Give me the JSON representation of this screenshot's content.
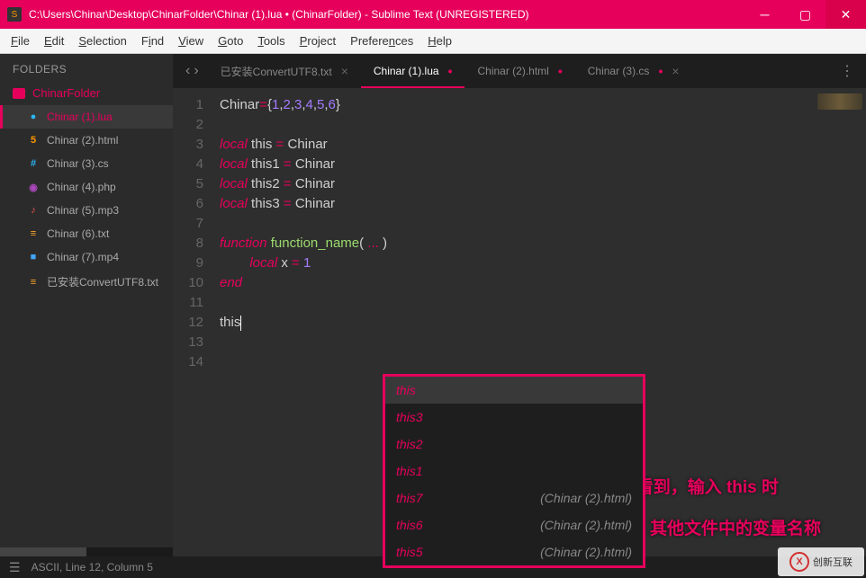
{
  "title": "C:\\Users\\Chinar\\Desktop\\ChinarFolder\\Chinar (1).lua • (ChinarFolder) - Sublime Text (UNREGISTERED)",
  "titlebar_icon": "S",
  "menu": [
    "File",
    "Edit",
    "Selection",
    "Find",
    "View",
    "Goto",
    "Tools",
    "Project",
    "Preferences",
    "Help"
  ],
  "sidebar": {
    "header": "FOLDERS",
    "folder": "ChinarFolder",
    "files": [
      {
        "name": "Chinar (1).lua",
        "icon": "●",
        "cls": "ic-lua",
        "active": true
      },
      {
        "name": "Chinar (2).html",
        "icon": "5",
        "cls": "ic-html"
      },
      {
        "name": "Chinar (3).cs",
        "icon": "#",
        "cls": "ic-cs"
      },
      {
        "name": "Chinar (4).php",
        "icon": "◉",
        "cls": "ic-php"
      },
      {
        "name": "Chinar (5).mp3",
        "icon": "♪",
        "cls": "ic-mp3"
      },
      {
        "name": "Chinar (6).txt",
        "icon": "≡",
        "cls": "ic-txt"
      },
      {
        "name": "Chinar (7).mp4",
        "icon": "■",
        "cls": "ic-mp4"
      },
      {
        "name": "已安装ConvertUTF8.txt",
        "icon": "≡",
        "cls": "ic-txt"
      }
    ]
  },
  "tabs": [
    {
      "label": "已安装ConvertUTF8.txt",
      "dirty": false,
      "active": false,
      "showclose": true
    },
    {
      "label": "Chinar (1).lua",
      "dirty": true,
      "active": true
    },
    {
      "label": "Chinar (2).html",
      "dirty": true,
      "active": false
    },
    {
      "label": "Chinar (3).cs",
      "dirty": true,
      "active": false,
      "showclose": true
    }
  ],
  "code": {
    "lines": [
      "1",
      "2",
      "3",
      "4",
      "5",
      "6",
      "7",
      "8",
      "9",
      "10",
      "11",
      "12",
      "13",
      "14"
    ],
    "l1_ident": "Chinar",
    "l1_vals": [
      "1",
      "2",
      "3",
      "4",
      "5",
      "6"
    ],
    "l3_kw": "local",
    "l3_v": "this",
    "l3_r": "Chinar",
    "l4_kw": "local",
    "l4_v": "this1",
    "l4_r": "Chinar",
    "l5_kw": "local",
    "l5_v": "this2",
    "l5_r": "Chinar",
    "l6_kw": "local",
    "l6_v": "this3",
    "l6_r": "Chinar",
    "l8_kw": "function",
    "l8_fn": "function_name",
    "l8_args": "...",
    "l9_kw": "local",
    "l9_v": "x",
    "l9_r": "1",
    "l10_kw": "end",
    "l12_text": "this"
  },
  "autocomplete": [
    {
      "t": "this",
      "hint": "",
      "sel": true
    },
    {
      "t": "this3",
      "hint": ""
    },
    {
      "t": "this2",
      "hint": ""
    },
    {
      "t": "this1",
      "hint": ""
    },
    {
      "t": "this7",
      "hint": "(Chinar (2).html)"
    },
    {
      "t": "this6",
      "hint": "(Chinar (2).html)"
    },
    {
      "t": "this5",
      "hint": "(Chinar (2).html)"
    }
  ],
  "annotation": {
    "line1": "可以看到，输入 this 时",
    "line2": "会自动提示 其他文件中的变量名称"
  },
  "status": "ASCII, Line 12, Column 5",
  "watermark": "创新互联"
}
